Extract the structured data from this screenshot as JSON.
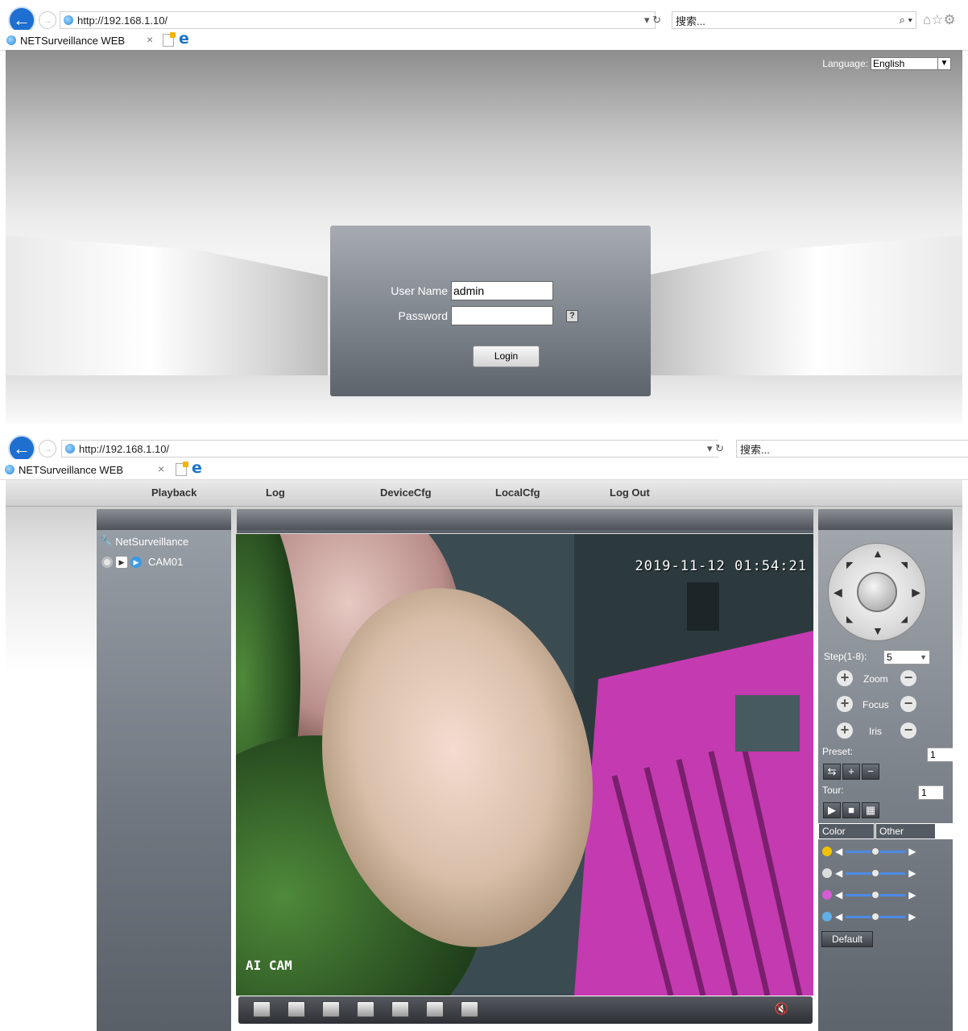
{
  "browser1": {
    "url_prefix": "http://",
    "url_host": "192.168.1.10/",
    "search_placeholder": "搜索...",
    "tab_title": "NETSurveillance WEB"
  },
  "login": {
    "language_label": "Language:",
    "language_value": "English",
    "username_label": "User Name",
    "username_value": "admin",
    "password_label": "Password",
    "password_value": "",
    "help_glyph": "?",
    "login_button": "Login"
  },
  "browser2": {
    "url_prefix": "http://",
    "url_host": "192.168.1.10/",
    "search_placeholder": "搜索...",
    "tab_title": "NETSurveillance WEB"
  },
  "nav": {
    "items": [
      "Playback",
      "Log",
      "DeviceCfg",
      "LocalCfg",
      "Log Out"
    ]
  },
  "tree": {
    "root": "NetSurveillance",
    "camera": "CAM01"
  },
  "video": {
    "timestamp": "2019-11-12 01:54:21",
    "overlay_label": "AI CAM"
  },
  "ptz": {
    "step_label": "Step(1-8):",
    "step_value": "5",
    "zoom_label": "Zoom",
    "focus_label": "Focus",
    "iris_label": "Iris",
    "preset_label": "Preset:",
    "preset_value": "1",
    "tour_label": "Tour:",
    "tour_value": "1",
    "color_tab": "Color",
    "other_tab": "Other",
    "default_button": "Default",
    "sliders": [
      {
        "name": "brightness",
        "value": 0.5,
        "color": "#f2c200"
      },
      {
        "name": "contrast",
        "value": 0.5,
        "color": "#dddddd"
      },
      {
        "name": "saturation",
        "value": 0.5,
        "color": "#d65cd6"
      },
      {
        "name": "hue",
        "value": 0.5,
        "color": "#5fb0e6"
      }
    ]
  },
  "colors": {
    "accent_blue": "#1e6fd0",
    "panel_gray": "#6f767f",
    "slider_blue": "#4d8be5"
  }
}
